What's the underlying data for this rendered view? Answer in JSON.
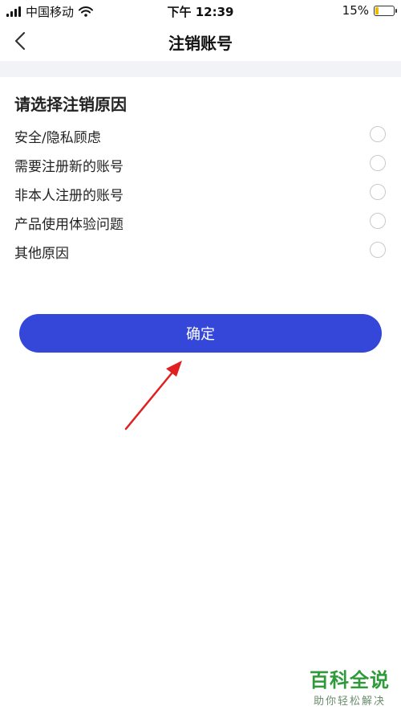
{
  "status_bar": {
    "carrier": "中国移动",
    "time": "下午 12:39",
    "battery": "15%"
  },
  "nav": {
    "title": "注销账号"
  },
  "section_title": "请选择注销原因",
  "reasons": [
    {
      "label": "安全/隐私顾虑"
    },
    {
      "label": "需要注册新的账号"
    },
    {
      "label": "非本人注册的账号"
    },
    {
      "label": "产品使用体验问题"
    },
    {
      "label": "其他原因"
    }
  ],
  "confirm_label": "确定",
  "watermark": {
    "title": "百科全说",
    "subtitle": "助你轻松解决"
  },
  "colors": {
    "primary": "#3447d9",
    "separator": "#f2f3f7",
    "annotation": "#e02020"
  }
}
